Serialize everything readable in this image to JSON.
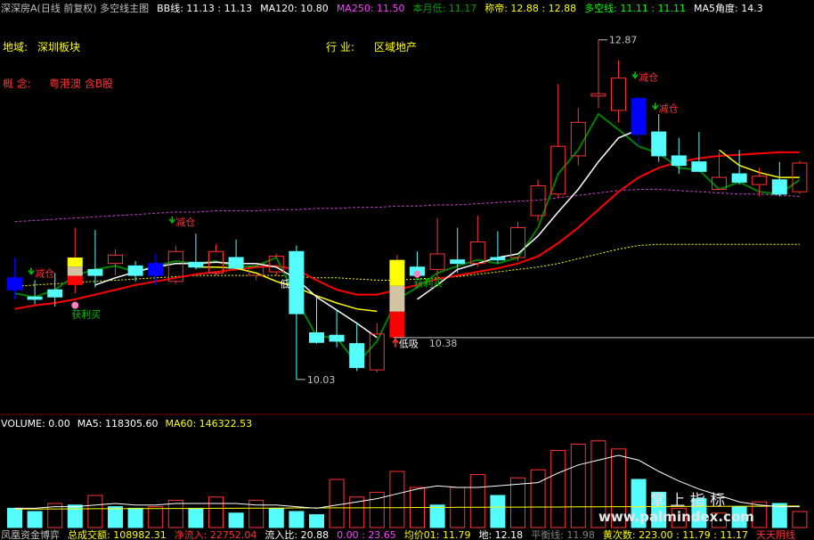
{
  "colors": {
    "up": "#ff3232",
    "down": "#54fcfc",
    "ma5": "#ffffff",
    "ma10": "#ffff00",
    "bb": "#008000",
    "bull_bear": "#ff0000",
    "ma120": "#ffff00",
    "ma250": "#c040c0",
    "label": "#ffff00",
    "concept": "#ff3232",
    "signal_green": "#00c000",
    "signal_red": "#ff3232",
    "blue_bar": "#0000ff"
  },
  "header": {
    "items": [
      {
        "text": "深深房A(日线 前复权) 多空线主图",
        "color": "#c0c0c0"
      },
      {
        "text": "BB线: 11.13 : 11.13",
        "color": "#ffffff"
      },
      {
        "text": "MA120: 10.80",
        "color": "#ffffff"
      },
      {
        "text": "MA250: 11.50",
        "color": "#ff40ff"
      },
      {
        "text": "本月低: 11.17",
        "color": "#00a000"
      },
      {
        "text": "称帝: 12.88 : 12.88",
        "color": "#ffff00"
      },
      {
        "text": "多空线: 11.11 : 11.11",
        "color": "#00ff00"
      },
      {
        "text": "MA5角度: 14.3",
        "color": "#ffffff"
      }
    ]
  },
  "info": {
    "region_label": "地域:",
    "region_value": "深圳板块",
    "industry_label": "行  业:",
    "industry_value": "区域地产",
    "concept_label": "概  念:",
    "concept_value": "粤港澳 含B股"
  },
  "annotations": {
    "high_price": "12.87",
    "low_price": "10.03",
    "mid_price": "10.38",
    "reduce": "减仓",
    "profit_buy": "获利买",
    "low_buy": "低吸",
    "low_short": "低"
  },
  "volume_header": {
    "items": [
      {
        "text": "VOLUME: 0.00",
        "color": "#ffffff"
      },
      {
        "text": "MA5: 118305.60",
        "color": "#ffffff"
      },
      {
        "text": "MA60: 146322.53",
        "color": "#ffff00"
      }
    ]
  },
  "footer": {
    "items": [
      {
        "text": "凤凰资金博弈",
        "color": "#c0c0c0"
      },
      {
        "text": "总成交额: 108982.31",
        "color": "#ffff00"
      },
      {
        "text": "净流入: 22752.04",
        "color": "#ff3232"
      },
      {
        "text": "流入比: 20.88",
        "color": "#ffffff"
      },
      {
        "text": "0.00 : 23.65",
        "color": "#ff40ff"
      },
      {
        "text": "均价01: 11.79",
        "color": "#ffff00"
      },
      {
        "text": "地: 12.18",
        "color": "#ffffff"
      },
      {
        "text": "平衡线: 11.98",
        "color": "#808080"
      },
      {
        "text": "黄次数: 223.00 : 11.79 : 11.17",
        "color": "#ffff00"
      },
      {
        "text": "天天阴线",
        "color": "#ff3232"
      }
    ]
  },
  "watermark": {
    "line1": "掌 上 指 标",
    "line2": "www.palmindex.com"
  },
  "chart_data": {
    "type": "candlestick",
    "price_axis": [
      9.85,
      12.95
    ],
    "volume_axis": [
      0,
      6
    ],
    "candles": [
      {
        "o": 10.88,
        "h": 11.05,
        "l": 10.7,
        "c": 10.78,
        "color": "blue"
      },
      {
        "o": 10.7,
        "h": 10.86,
        "l": 10.66,
        "c": 10.72,
        "color": "down"
      },
      {
        "o": 10.72,
        "h": 10.92,
        "l": 10.64,
        "c": 10.78,
        "color": "down"
      },
      {
        "o": 10.82,
        "h": 11.3,
        "l": 10.75,
        "c": 11.05,
        "color": "split"
      },
      {
        "o": 10.9,
        "h": 11.28,
        "l": 10.8,
        "c": 10.95,
        "color": "down"
      },
      {
        "o": 11.0,
        "h": 11.12,
        "l": 10.9,
        "c": 11.07,
        "color": "up"
      },
      {
        "o": 10.98,
        "h": 11.02,
        "l": 10.85,
        "c": 10.9,
        "color": "down"
      },
      {
        "o": 10.9,
        "h": 11.08,
        "l": 10.82,
        "c": 11.0,
        "color": "blue"
      },
      {
        "o": 10.85,
        "h": 11.15,
        "l": 10.83,
        "c": 11.1,
        "color": "up"
      },
      {
        "o": 11.01,
        "h": 11.25,
        "l": 10.95,
        "c": 10.97,
        "color": "down"
      },
      {
        "o": 10.92,
        "h": 11.16,
        "l": 10.9,
        "c": 11.1,
        "color": "up"
      },
      {
        "o": 11.05,
        "h": 11.2,
        "l": 10.98,
        "c": 10.96,
        "color": "down"
      },
      {
        "o": 10.9,
        "h": 11.0,
        "l": 10.86,
        "c": 10.97,
        "color": "up"
      },
      {
        "o": 10.93,
        "h": 11.08,
        "l": 10.9,
        "c": 11.06,
        "color": "up"
      },
      {
        "o": 11.1,
        "h": 11.15,
        "l": 10.03,
        "c": 10.58,
        "color": "down"
      },
      {
        "o": 10.42,
        "h": 10.72,
        "l": 10.33,
        "c": 10.34,
        "color": "down"
      },
      {
        "o": 10.4,
        "h": 10.62,
        "l": 10.3,
        "c": 10.35,
        "color": "down"
      },
      {
        "o": 10.33,
        "h": 10.5,
        "l": 10.1,
        "c": 10.13,
        "color": "down"
      },
      {
        "o": 10.11,
        "h": 10.5,
        "l": 10.09,
        "c": 10.41,
        "color": "up"
      },
      {
        "o": 10.38,
        "h": 11.07,
        "l": 10.38,
        "c": 11.03,
        "color": "split"
      },
      {
        "o": 10.97,
        "h": 11.1,
        "l": 10.88,
        "c": 10.9,
        "color": "down"
      },
      {
        "o": 10.95,
        "h": 11.38,
        "l": 10.88,
        "c": 11.08,
        "color": "up"
      },
      {
        "o": 11.0,
        "h": 11.3,
        "l": 10.92,
        "c": 11.03,
        "color": "down"
      },
      {
        "o": 11.0,
        "h": 11.4,
        "l": 10.97,
        "c": 11.18,
        "color": "up"
      },
      {
        "o": 11.05,
        "h": 11.27,
        "l": 11.0,
        "c": 11.03,
        "color": "down"
      },
      {
        "o": 11.05,
        "h": 11.35,
        "l": 11.02,
        "c": 11.3,
        "color": "up"
      },
      {
        "o": 11.4,
        "h": 11.7,
        "l": 11.35,
        "c": 11.65,
        "color": "up"
      },
      {
        "o": 11.58,
        "h": 12.5,
        "l": 11.55,
        "c": 11.98,
        "color": "up"
      },
      {
        "o": 11.9,
        "h": 12.3,
        "l": 11.82,
        "c": 12.18,
        "color": "up"
      },
      {
        "o": 12.4,
        "h": 12.87,
        "l": 12.3,
        "c": 12.42,
        "color": "up"
      },
      {
        "o": 12.28,
        "h": 12.7,
        "l": 12.18,
        "c": 12.55,
        "color": "up"
      },
      {
        "o": 12.38,
        "h": 12.4,
        "l": 11.98,
        "c": 12.08,
        "color": "blue"
      },
      {
        "o": 12.1,
        "h": 12.25,
        "l": 11.85,
        "c": 11.9,
        "color": "down"
      },
      {
        "o": 11.9,
        "h": 12.05,
        "l": 11.75,
        "c": 11.82,
        "color": "down"
      },
      {
        "o": 11.85,
        "h": 12.1,
        "l": 11.78,
        "c": 11.77,
        "color": "down"
      },
      {
        "o": 11.72,
        "h": 11.93,
        "l": 11.62,
        "c": 11.62,
        "color": "up"
      },
      {
        "o": 11.75,
        "h": 11.95,
        "l": 11.66,
        "c": 11.68,
        "color": "down"
      },
      {
        "o": 11.66,
        "h": 11.8,
        "l": 11.56,
        "c": 11.73,
        "color": "up"
      },
      {
        "o": 11.7,
        "h": 11.85,
        "l": 11.56,
        "c": 11.58,
        "color": "down"
      },
      {
        "o": 11.6,
        "h": 11.86,
        "l": 11.58,
        "c": 11.84,
        "color": "up"
      }
    ],
    "bull_bear_line": [
      10.62,
      10.65,
      10.67,
      10.7,
      10.74,
      10.78,
      10.82,
      10.85,
      10.88,
      10.91,
      10.93,
      10.95,
      10.97,
      10.98,
      10.95,
      10.86,
      10.78,
      10.74,
      10.74,
      10.78,
      10.82,
      10.87,
      10.9,
      10.93,
      10.96,
      11.0,
      11.06,
      11.17,
      11.3,
      11.45,
      11.6,
      11.72,
      11.8,
      11.85,
      11.88,
      11.9,
      11.91,
      11.92,
      11.93,
      11.93
    ],
    "bb_line": [
      10.75,
      10.72,
      10.78,
      10.9,
      10.95,
      10.98,
      10.93,
      10.98,
      11.02,
      11.0,
      11.02,
      10.97,
      10.98,
      11.05,
      10.7,
      10.39,
      10.38,
      10.16,
      10.35,
      10.7,
      10.8,
      10.92,
      10.98,
      11.03,
      11.0,
      11.05,
      11.3,
      11.75,
      11.95,
      12.25,
      12.12,
      11.98,
      11.92,
      11.8,
      11.78,
      11.62,
      11.68,
      11.6,
      11.58,
      11.7
    ],
    "ma5_line": [
      null,
      null,
      null,
      null,
      10.82,
      10.88,
      10.93,
      10.97,
      11.0,
      11.0,
      11.01,
      11.0,
      11.0,
      10.97,
      10.87,
      10.72,
      10.61,
      10.5,
      10.38,
      null,
      10.7,
      10.82,
      10.95,
      11.0,
      11.05,
      11.08,
      11.23,
      11.43,
      11.62,
      11.85,
      12.05,
      12.12,
      null,
      null,
      null,
      null,
      null,
      null,
      null,
      null
    ],
    "ma10_line": [
      null,
      null,
      null,
      null,
      null,
      null,
      null,
      null,
      null,
      10.97,
      10.97,
      10.96,
      10.92,
      10.85,
      10.8,
      10.73,
      10.67,
      10.62,
      10.6,
      null,
      null,
      null,
      null,
      null,
      null,
      null,
      null,
      null,
      null,
      null,
      null,
      null,
      null,
      null,
      null,
      11.95,
      11.82,
      11.76,
      11.72,
      11.72
    ],
    "ma120_line": [
      10.81,
      10.82,
      10.83,
      10.84,
      10.85,
      10.86,
      10.87,
      10.88,
      10.89,
      10.9,
      10.9,
      10.9,
      10.9,
      10.9,
      10.89,
      10.88,
      10.88,
      10.87,
      10.86,
      10.86,
      10.87,
      10.88,
      10.89,
      10.91,
      10.93,
      10.95,
      10.97,
      11.0,
      11.04,
      11.08,
      11.12,
      11.15,
      11.16,
      11.16,
      11.16,
      11.16,
      11.16,
      11.16,
      11.16,
      11.16
    ],
    "ma250_line": [
      11.35,
      11.36,
      11.37,
      11.38,
      11.39,
      11.4,
      11.41,
      11.42,
      11.43,
      11.43,
      11.44,
      11.44,
      11.44,
      11.45,
      11.45,
      11.46,
      11.46,
      11.47,
      11.47,
      11.48,
      11.48,
      11.49,
      11.49,
      11.5,
      11.51,
      11.52,
      11.53,
      11.55,
      11.57,
      11.59,
      11.61,
      11.62,
      11.62,
      11.61,
      11.6,
      11.59,
      11.58,
      11.58,
      11.57,
      11.56
    ],
    "volumes": [
      {
        "v": 1.2,
        "color": "down"
      },
      {
        "v": 1.0,
        "color": "down"
      },
      {
        "v": 1.5,
        "color": "up"
      },
      {
        "v": 1.4,
        "color": "down"
      },
      {
        "v": 2.0,
        "color": "up"
      },
      {
        "v": 1.3,
        "color": "down"
      },
      {
        "v": 1.2,
        "color": "down"
      },
      {
        "v": 1.3,
        "color": "up"
      },
      {
        "v": 1.7,
        "color": "up"
      },
      {
        "v": 1.2,
        "color": "down"
      },
      {
        "v": 1.9,
        "color": "up"
      },
      {
        "v": 0.9,
        "color": "down"
      },
      {
        "v": 1.7,
        "color": "up"
      },
      {
        "v": 1.2,
        "color": "down"
      },
      {
        "v": 1.0,
        "color": "down"
      },
      {
        "v": 0.8,
        "color": "down"
      },
      {
        "v": 3.0,
        "color": "up"
      },
      {
        "v": 1.9,
        "color": "up"
      },
      {
        "v": 2.2,
        "color": "up"
      },
      {
        "v": 3.5,
        "color": "up"
      },
      {
        "v": 2.5,
        "color": "up"
      },
      {
        "v": 1.4,
        "color": "down"
      },
      {
        "v": 2.5,
        "color": "up"
      },
      {
        "v": 3.3,
        "color": "up"
      },
      {
        "v": 2.0,
        "color": "down"
      },
      {
        "v": 3.1,
        "color": "up"
      },
      {
        "v": 3.6,
        "color": "up"
      },
      {
        "v": 4.8,
        "color": "up"
      },
      {
        "v": 5.2,
        "color": "up"
      },
      {
        "v": 5.4,
        "color": "up"
      },
      {
        "v": 4.9,
        "color": "up"
      },
      {
        "v": 3.0,
        "color": "down"
      },
      {
        "v": 2.2,
        "color": "down"
      },
      {
        "v": 1.2,
        "color": "up"
      },
      {
        "v": 1.8,
        "color": "down"
      },
      {
        "v": 0.9,
        "color": "up"
      },
      {
        "v": 1.3,
        "color": "down"
      },
      {
        "v": 1.6,
        "color": "up"
      },
      {
        "v": 1.5,
        "color": "down"
      },
      {
        "v": 1.0,
        "color": "up"
      }
    ],
    "volume_ma5": [
      1.2,
      1.2,
      1.3,
      1.3,
      1.4,
      1.5,
      1.4,
      1.4,
      1.5,
      1.5,
      1.5,
      1.5,
      1.4,
      1.4,
      1.3,
      1.2,
      1.4,
      1.6,
      1.8,
      2.1,
      2.4,
      2.6,
      2.5,
      2.5,
      2.6,
      2.7,
      2.8,
      3.4,
      3.9,
      4.2,
      4.5,
      4.2,
      3.5,
      2.9,
      2.4,
      2.0,
      1.6,
      1.4,
      1.3,
      1.3
    ],
    "volume_ma60": [
      1.15,
      1.15,
      1.16,
      1.16,
      1.17,
      1.17,
      1.18,
      1.18,
      1.19,
      1.19,
      1.2,
      1.2,
      1.21,
      1.21,
      1.22,
      1.22,
      1.23,
      1.23,
      1.24,
      1.24,
      1.25,
      1.25,
      1.26,
      1.26,
      1.27,
      1.27,
      1.28,
      1.28,
      1.29,
      1.29,
      1.3,
      1.3,
      1.31,
      1.31,
      1.32,
      1.32,
      1.33,
      1.33,
      1.34,
      1.34
    ]
  }
}
